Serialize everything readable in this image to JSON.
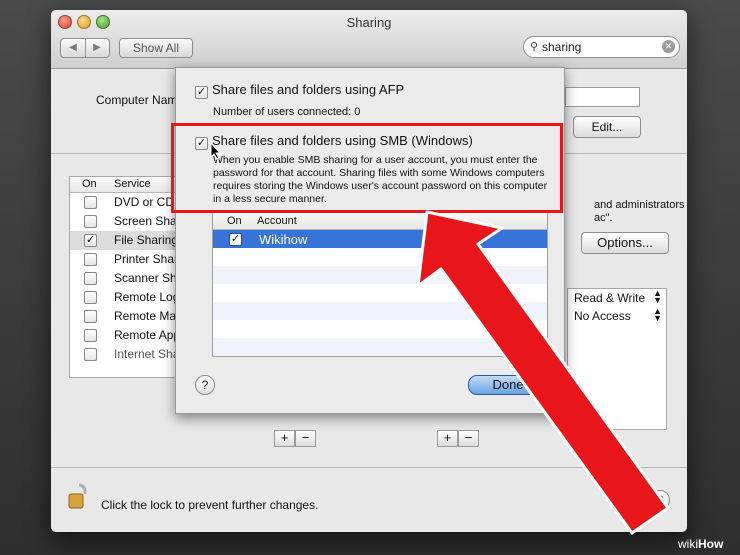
{
  "window": {
    "title": "Sharing",
    "nav_back": "◀",
    "nav_forward": "▶",
    "show_all": "Show All",
    "search_value": "sharing"
  },
  "computer_name": {
    "label": "Computer Name",
    "edit_label": "Edit..."
  },
  "services": {
    "col_on": "On",
    "col_service": "Service",
    "items": [
      {
        "label": "DVD or CD",
        "checked": false
      },
      {
        "label": "Screen Sharing",
        "checked": false
      },
      {
        "label": "File Sharing",
        "checked": true
      },
      {
        "label": "Printer Sharing",
        "checked": false
      },
      {
        "label": "Scanner Sharing",
        "checked": false
      },
      {
        "label": "Remote Login",
        "checked": false
      },
      {
        "label": "Remote Management",
        "checked": false
      },
      {
        "label": "Remote Apple Events",
        "checked": false
      },
      {
        "label": "Internet Sharing",
        "checked": false
      }
    ]
  },
  "right_panel": {
    "text_line1": "and administrators",
    "text_line2": "ac\".",
    "options_label": "Options...",
    "permissions": [
      "Read & Write",
      "No Access"
    ]
  },
  "plus_minus": {
    "plus": "+",
    "minus": "−"
  },
  "lock_text": "Click the lock to prevent further changes.",
  "help_label": "?",
  "sheet": {
    "afp_label": "Share files and folders using AFP",
    "afp_users": "Number of users connected: 0",
    "smb_label": "Share files and folders using SMB (Windows)",
    "smb_desc": "When you enable SMB sharing for a user account, you must enter the password for that account. Sharing files with some Windows computers requires storing the Windows user's account password on this computer in a less secure manner.",
    "table_col_on": "On",
    "table_col_account": "Account",
    "accounts": [
      {
        "name": "Wikihow",
        "checked": true
      }
    ],
    "done_label": "Done"
  },
  "watermark": {
    "prefix": "wiki",
    "suffix": "How"
  },
  "colors": {
    "highlight": "#e8151b",
    "selection": "#3874d7"
  }
}
